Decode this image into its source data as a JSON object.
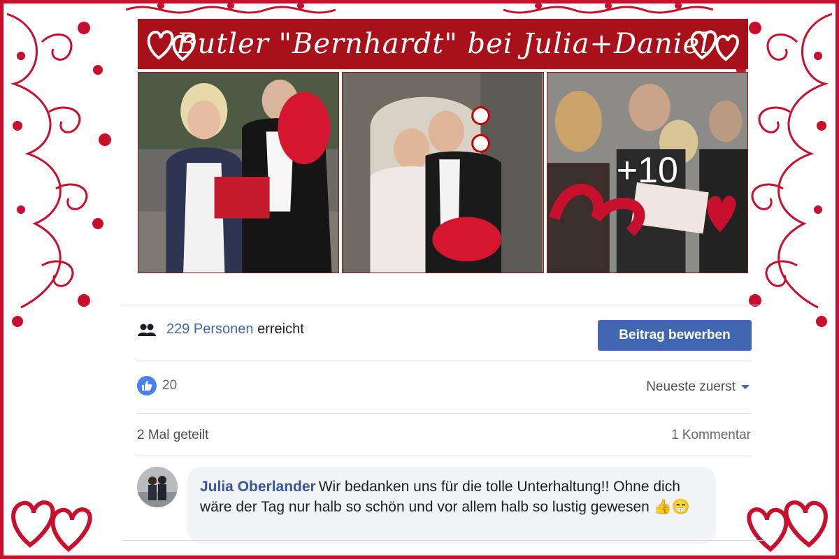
{
  "banner": {
    "title": "Butler \"Bernhardt\" bei Julia+Daniel"
  },
  "photos": {
    "more_count": "+10"
  },
  "reach": {
    "count": "229 Personen",
    "suffix": "erreicht",
    "promote_label": "Beitrag bewerben"
  },
  "reactions": {
    "like_count": "20",
    "sort_label": "Neueste zuerst"
  },
  "stats": {
    "shares": "2 Mal geteilt",
    "comments": "1 Kommentar"
  },
  "comment": {
    "author": "Julia Oberlander",
    "text": "Wir bedanken uns für die tolle Unterhaltung!! Ohne dich wäre der Tag nur halb so schön und vor allem halb so lustig gewesen",
    "emojis": "👍😁"
  },
  "colors": {
    "frame_red": "#c8102e",
    "banner_red": "#a8101a",
    "fb_blue": "#4267b2"
  },
  "icons": [
    "heart-icon",
    "people-icon",
    "like-icon",
    "caret-down-icon"
  ]
}
